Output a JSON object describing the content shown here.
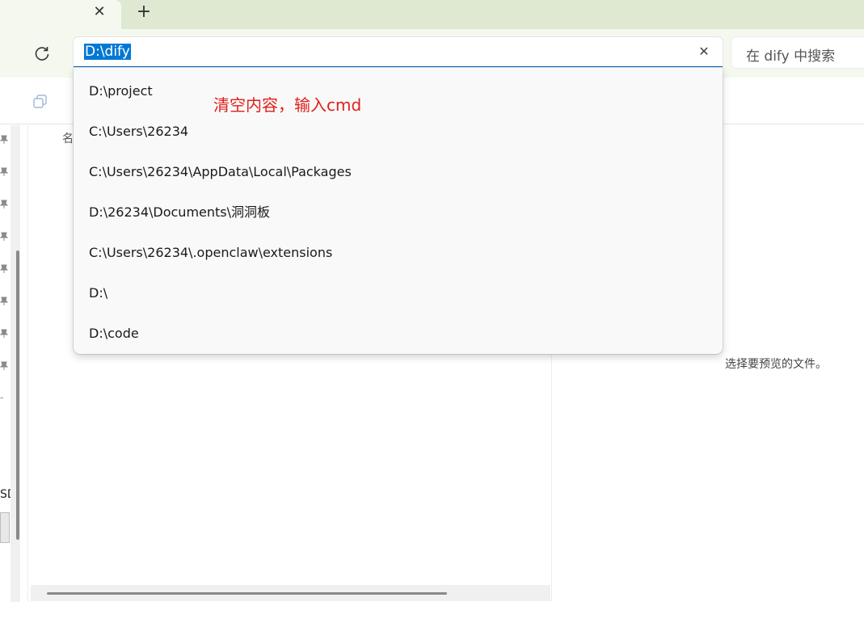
{
  "tabbar": {
    "close_glyph": "✕",
    "new_glyph": "+"
  },
  "address": {
    "value": "D:\\dify",
    "clear_glyph": "✕"
  },
  "search": {
    "placeholder": "在 dify 中搜索"
  },
  "main": {
    "column_header": "名"
  },
  "dropdown": {
    "items": [
      {
        "label": "D:\\project"
      },
      {
        "label": "C:\\Users\\26234"
      },
      {
        "label": "C:\\Users\\26234\\AppData\\Local\\Packages"
      },
      {
        "label": "D:\\26234\\Documents\\洞洞板"
      },
      {
        "label": "C:\\Users\\26234\\.openclaw\\extensions"
      },
      {
        "label": "D:\\"
      },
      {
        "label": "D:\\code"
      }
    ]
  },
  "annotation": {
    "text": "清空内容，输入cmd"
  },
  "preview": {
    "text": "选择要预览的文件。"
  },
  "leftpane": {
    "letter": "SD",
    "dash": "-"
  },
  "colors": {
    "accent": "#0067c0",
    "selection": "#0078d4",
    "annotation": "#e0201b",
    "tabbar": "#dfe9d2"
  },
  "icons": {
    "refresh": "refresh-icon",
    "copy": "copy-icon",
    "pin": "pin-icon",
    "close": "close-icon",
    "plus": "plus-icon"
  }
}
